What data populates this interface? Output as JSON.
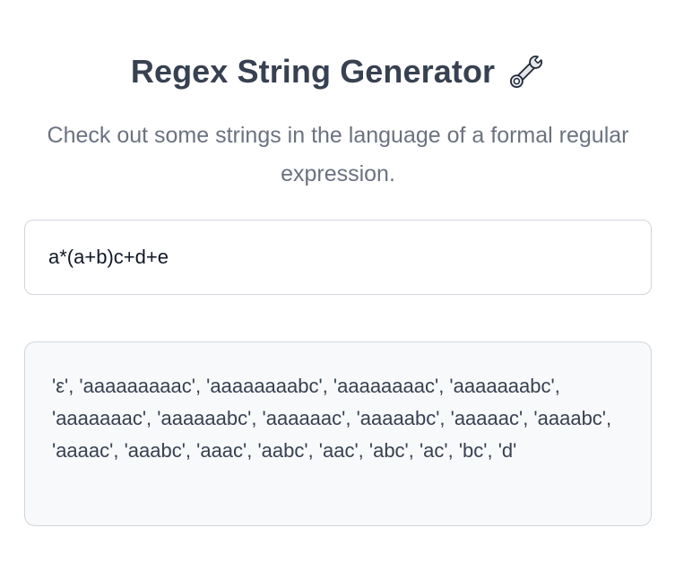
{
  "header": {
    "title": "Regex String Generator",
    "icon": "wrench-icon"
  },
  "description": "Check out some strings in the language of a formal regular expression.",
  "regex_input": {
    "value": "a*(a+b)c+d+e"
  },
  "results": {
    "text": "'ε', 'aaaaaaaaac', 'aaaaaaaabc', 'aaaaaaaac', 'aaaaaaabc', 'aaaaaaac', 'aaaaaabc', 'aaaaaac', 'aaaaabc', 'aaaaac', 'aaaabc', 'aaaac', 'aaabc', 'aaac', 'aabc', 'aac', 'abc', 'ac', 'bc', 'd'"
  },
  "colors": {
    "text": "#374151",
    "muted": "#6b7280",
    "border": "#d1d5db",
    "results_bg": "#f8f9fb"
  }
}
